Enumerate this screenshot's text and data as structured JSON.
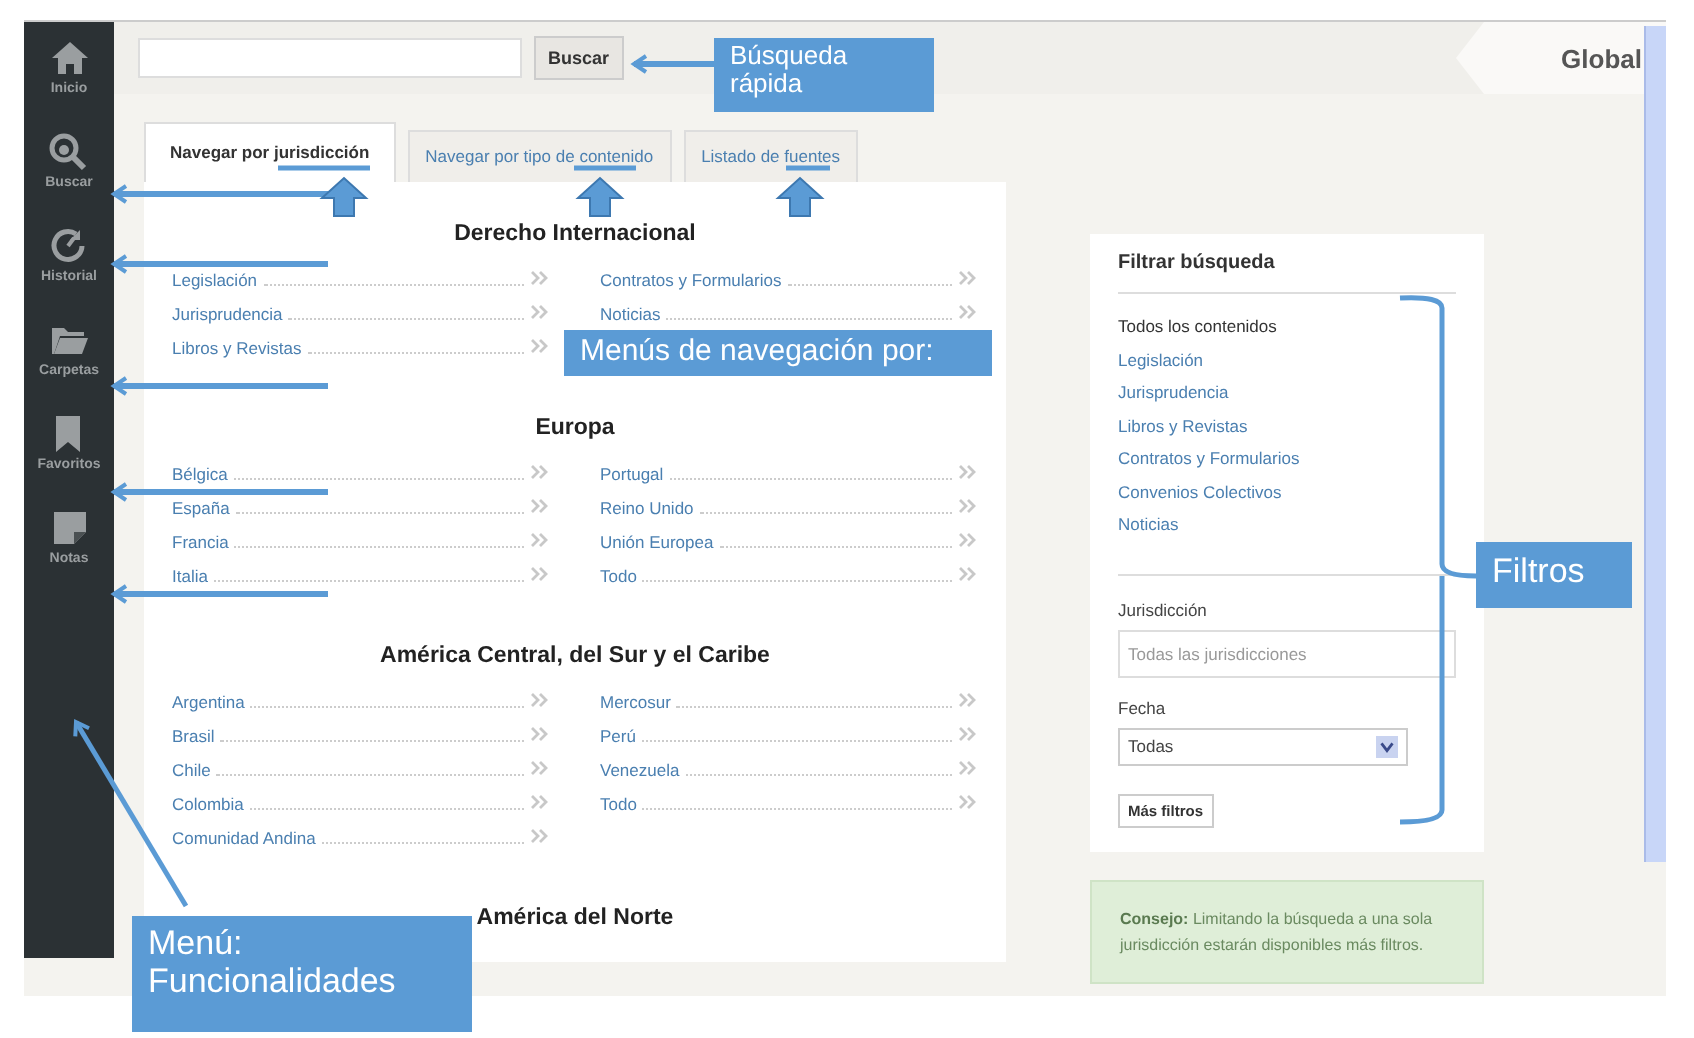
{
  "sidebar": {
    "items": [
      {
        "label": "Inicio"
      },
      {
        "label": "Buscar"
      },
      {
        "label": "Historial"
      },
      {
        "label": "Carpetas"
      },
      {
        "label": "Favoritos"
      },
      {
        "label": "Notas"
      }
    ]
  },
  "topbar": {
    "search_button": "Buscar",
    "scope": "Global"
  },
  "tabs": [
    {
      "label": "Navegar por jurisdicción",
      "selected": true
    },
    {
      "label": "Navegar por tipo de contenido",
      "selected": false
    },
    {
      "label": "Listado de fuentes",
      "selected": false
    }
  ],
  "sections": [
    {
      "title": "Derecho Internacional",
      "left": [
        "Legislación",
        "Jurisprudencia",
        "Libros y Revistas"
      ],
      "right": [
        "Contratos y Formularios",
        "Noticias"
      ]
    },
    {
      "title": "Europa",
      "left": [
        "Bélgica",
        "España",
        "Francia",
        "Italia"
      ],
      "right": [
        "Portugal",
        "Reino Unido",
        "Unión Europea",
        "Todo"
      ]
    },
    {
      "title": "América Central, del Sur y el Caribe",
      "left": [
        "Argentina",
        "Brasil",
        "Chile",
        "Colombia",
        "Comunidad Andina"
      ],
      "right": [
        "Mercosur",
        "Perú",
        "Venezuela",
        "Todo"
      ]
    },
    {
      "title": "América del Norte"
    }
  ],
  "filter": {
    "title": "Filtrar búsqueda",
    "items": [
      {
        "label": "Todos los contenidos",
        "selected": true
      },
      {
        "label": "Legislación",
        "selected": false
      },
      {
        "label": "Jurisprudencia",
        "selected": false
      },
      {
        "label": "Libros y Revistas",
        "selected": false
      },
      {
        "label": "Contratos y Formularios",
        "selected": false
      },
      {
        "label": "Convenios Colectivos",
        "selected": false
      },
      {
        "label": "Noticias",
        "selected": false
      }
    ],
    "jurisdiction_label": "Jurisdicción",
    "jurisdiction_placeholder": "Todas las jurisdicciones",
    "date_label": "Fecha",
    "date_value": "Todas",
    "more_button": "Más filtros"
  },
  "tip": "**Consejo:** Limitando la búsqueda a una sola jurisdicción estarán disponibles más filtros.",
  "annotations": [
    {
      "text": "Búsqueda rápida"
    },
    {
      "text": "Menús de navegación por:"
    },
    {
      "text": "Filtros"
    },
    {
      "text": "Menú: Funcionalidades"
    }
  ]
}
